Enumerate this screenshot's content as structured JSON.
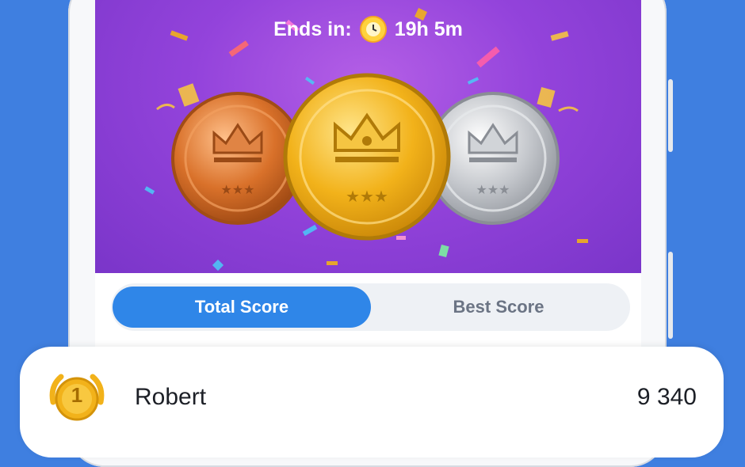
{
  "timer": {
    "label": "Ends in:",
    "value": "19h 5m"
  },
  "medals": {
    "bronze": "bronze-medal",
    "gold": "gold-medal",
    "silver": "silver-medal"
  },
  "tabs": [
    {
      "label": "Total Score",
      "active": true
    },
    {
      "label": "Best Score",
      "active": false
    }
  ],
  "leaderboard": {
    "rows": [
      {
        "rank": "1",
        "name": "Robert",
        "score": "9 340"
      }
    ]
  },
  "colors": {
    "background": "#3f7fe0",
    "hero": "#9343db",
    "accent": "#2f86e8",
    "gold": "#f2b21a",
    "silver": "#c4c7cc",
    "bronze": "#d9712a"
  }
}
